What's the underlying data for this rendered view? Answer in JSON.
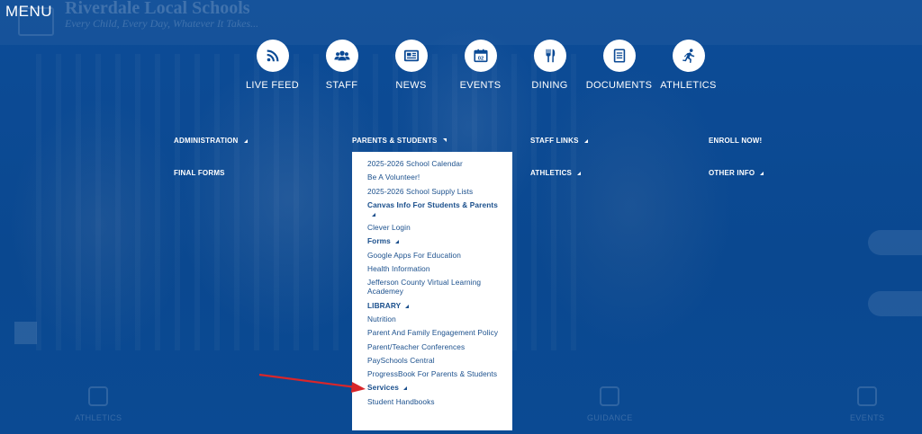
{
  "menu_label": "MENU",
  "site": {
    "title": "Riverdale Local Schools",
    "tagline": "Every Child, Every Day, Whatever It Takes..."
  },
  "quick_links": [
    {
      "label": "LIVE FEED",
      "icon": "rss-icon"
    },
    {
      "label": "STAFF",
      "icon": "staff-group-icon"
    },
    {
      "label": "NEWS",
      "icon": "newspaper-icon"
    },
    {
      "label": "EVENTS",
      "icon": "calendar-icon",
      "icon_text": "02"
    },
    {
      "label": "DINING",
      "icon": "fork-knife-icon"
    },
    {
      "label": "DOCUMENTS",
      "icon": "document-icon"
    },
    {
      "label": "ATHLETICS",
      "icon": "runner-icon"
    }
  ],
  "nav": {
    "administration": "ADMINISTRATION",
    "parents_students": "PARENTS & STUDENTS",
    "staff_links": "STAFF LINKS",
    "enroll_now": "ENROLL NOW!",
    "final_forms": "FINAL FORMS",
    "athletics": "ATHLETICS",
    "other_info": "OTHER INFO"
  },
  "dropdown": [
    {
      "label": "2025-2026 School Calendar",
      "bold": false,
      "submenu": false
    },
    {
      "label": "Be A Volunteer!",
      "bold": false,
      "submenu": false
    },
    {
      "label": "2025-2026 School Supply Lists",
      "bold": false,
      "submenu": false
    },
    {
      "label": "Canvas Info For Students & Parents",
      "bold": true,
      "submenu": true
    },
    {
      "label": "Clever Login",
      "bold": false,
      "submenu": false
    },
    {
      "label": "Forms",
      "bold": true,
      "submenu": true
    },
    {
      "label": "Google Apps For Education",
      "bold": false,
      "submenu": false
    },
    {
      "label": "Health Information",
      "bold": false,
      "submenu": false
    },
    {
      "label": "Jefferson County Virtual Learning Academey",
      "bold": false,
      "submenu": false
    },
    {
      "label": "LIBRARY",
      "bold": true,
      "submenu": true
    },
    {
      "label": "Nutrition",
      "bold": false,
      "submenu": false
    },
    {
      "label": "Parent And Family Engagement Policy",
      "bold": false,
      "submenu": false
    },
    {
      "label": "Parent/Teacher Conferences",
      "bold": false,
      "submenu": false
    },
    {
      "label": "PaySchools Central",
      "bold": false,
      "submenu": false
    },
    {
      "label": "ProgressBook For Parents & Students",
      "bold": false,
      "submenu": false
    },
    {
      "label": "Services",
      "bold": true,
      "submenu": true
    },
    {
      "label": "Student Handbooks",
      "bold": false,
      "submenu": false
    }
  ],
  "bottom_bar": {
    "athletics": "ATHLETICS",
    "guidance": "GUIDANCE",
    "events": "EVENTS"
  },
  "colors": {
    "background": "#0b4a95",
    "dropdown_text": "#1a4f8c",
    "annotation_arrow": "#d9262a"
  }
}
